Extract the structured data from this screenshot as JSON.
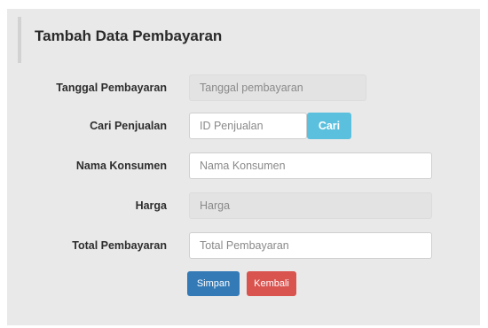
{
  "form": {
    "title": "Tambah Data Pembayaran",
    "tanggal": {
      "label": "Tanggal Pembayaran",
      "placeholder": "Tanggal pembayaran"
    },
    "penjualan": {
      "label": "Cari Penjualan",
      "placeholder": "ID Penjualan",
      "search_label": "Cari"
    },
    "konsumen": {
      "label": "Nama Konsumen",
      "placeholder": "Nama Konsumen"
    },
    "harga": {
      "label": "Harga",
      "placeholder": "Harga"
    },
    "total": {
      "label": "Total Pembayaran",
      "placeholder": "Total Pembayaran"
    },
    "buttons": {
      "save_label": "Simpan",
      "back_label": "Kembali"
    }
  },
  "colors": {
    "panel_bg": "#e9e9e9",
    "info": "#5bc0de",
    "primary": "#337ab7",
    "danger": "#d9534f"
  }
}
